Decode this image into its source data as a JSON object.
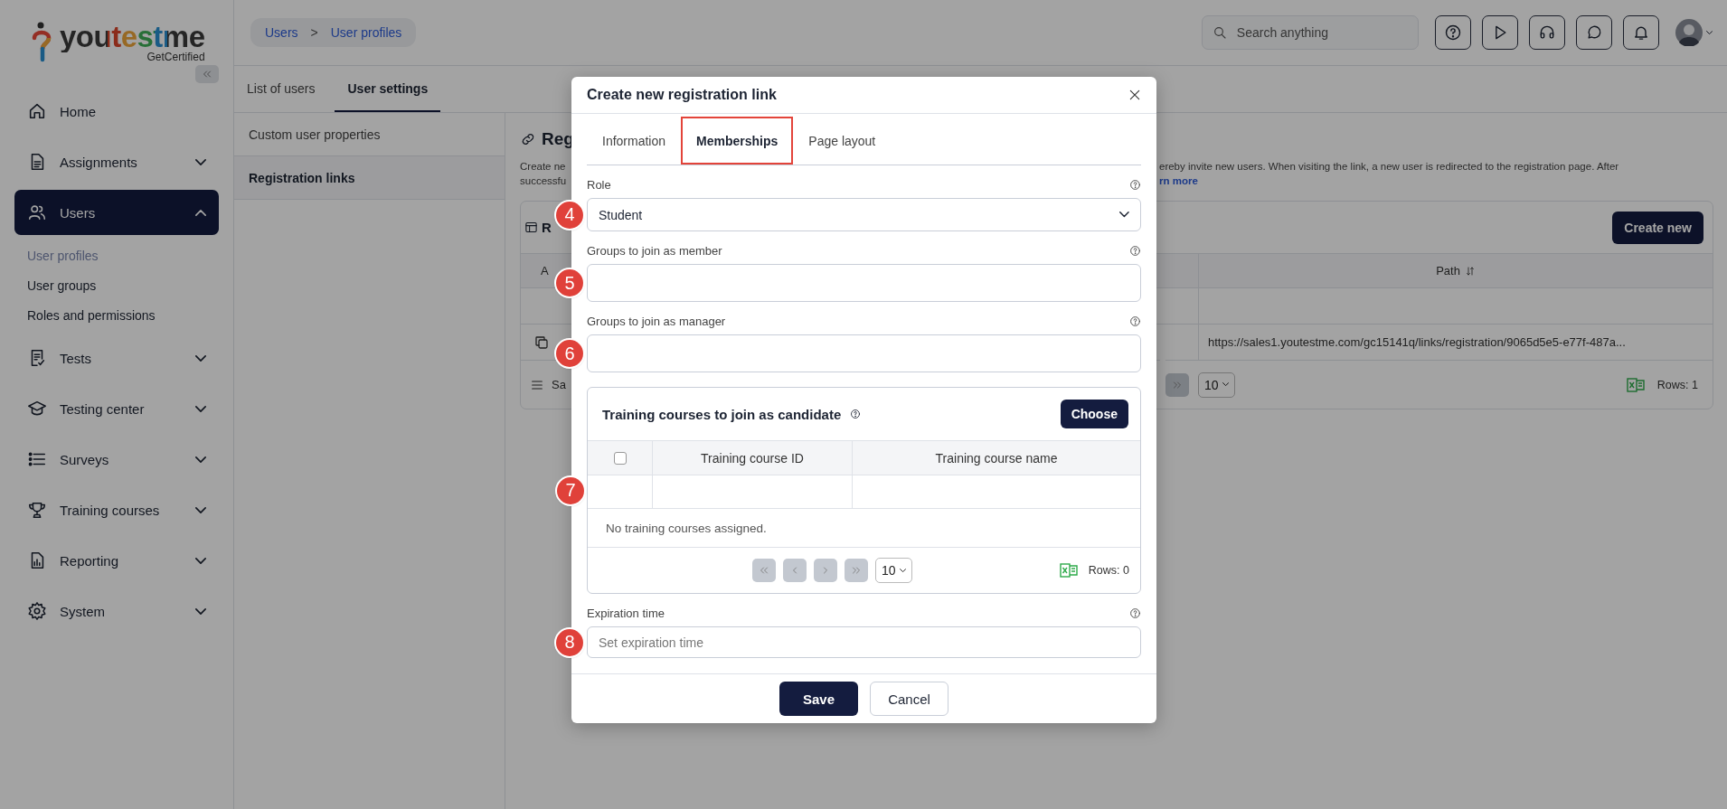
{
  "sidebar": {
    "logo": {
      "wordmark": "youtestme",
      "tagline": "GetCertified"
    },
    "items": [
      {
        "label": "Home",
        "selected": false
      },
      {
        "label": "Assignments",
        "selected": false,
        "expanded": false
      },
      {
        "label": "Users",
        "selected": true,
        "expanded": true,
        "children": [
          {
            "label": "User profiles",
            "selected": true
          },
          {
            "label": "User groups",
            "selected": false
          },
          {
            "label": "Roles and permissions",
            "selected": false
          }
        ]
      },
      {
        "label": "Tests",
        "selected": false,
        "expanded": false
      },
      {
        "label": "Testing center",
        "selected": false,
        "expanded": false
      },
      {
        "label": "Surveys",
        "selected": false,
        "expanded": false
      },
      {
        "label": "Training courses",
        "selected": false,
        "expanded": false
      },
      {
        "label": "Reporting",
        "selected": false,
        "expanded": false
      },
      {
        "label": "System",
        "selected": false,
        "expanded": false
      }
    ]
  },
  "header": {
    "breadcrumb": [
      "Users",
      "User profiles"
    ],
    "separator": ">",
    "search": {
      "placeholder": "Search anything"
    }
  },
  "page_tabs": [
    {
      "label": "List of users",
      "selected": false
    },
    {
      "label": "User settings",
      "selected": true
    }
  ],
  "settings_menu": [
    {
      "label": "Custom user properties",
      "selected": false
    },
    {
      "label": "Registration links",
      "selected": true
    }
  ],
  "content": {
    "title": "Reg",
    "description_left": [
      "Create ne",
      "successfu"
    ],
    "description_right": "ereby invite new users. When visiting the link, a new user is redirected to the registration page. After",
    "link": "rn more",
    "table": {
      "title": "R",
      "create_button": "Create new",
      "column_1": "A",
      "path_column": "Path",
      "url": "https://sales1.youtestme.com/gc15141q/links/registration/9065d5e5-e77f-487a...",
      "footer_text": "Sa",
      "page_size": "10",
      "rows": "Rows: 1"
    }
  },
  "modal": {
    "title": "Create new registration link",
    "tabs": [
      {
        "label": "Information",
        "selected": false,
        "highlighted": false
      },
      {
        "label": "Memberships",
        "selected": true,
        "highlighted": true
      },
      {
        "label": "Page layout",
        "selected": false,
        "highlighted": false
      }
    ],
    "fields": [
      {
        "kind": "select",
        "label": "Role",
        "value": "Student",
        "marker": "4"
      },
      {
        "kind": "input",
        "label": "Groups to join as member",
        "marker": "5"
      },
      {
        "kind": "input",
        "label": "Groups to join as manager",
        "marker": "6"
      }
    ],
    "courses": {
      "title": "Training courses to join as candidate",
      "marker": "7",
      "choose_button": "Choose",
      "select_all_checked": false,
      "columns": [
        "Training course ID",
        "Training course name"
      ],
      "empty_message": "No training courses assigned.",
      "page_size": "10",
      "rows": "Rows: 0"
    },
    "expiration": {
      "label": "Expiration time",
      "placeholder": "Set expiration time",
      "marker": "8"
    },
    "buttons": {
      "save": "Save",
      "cancel": "Cancel"
    }
  }
}
